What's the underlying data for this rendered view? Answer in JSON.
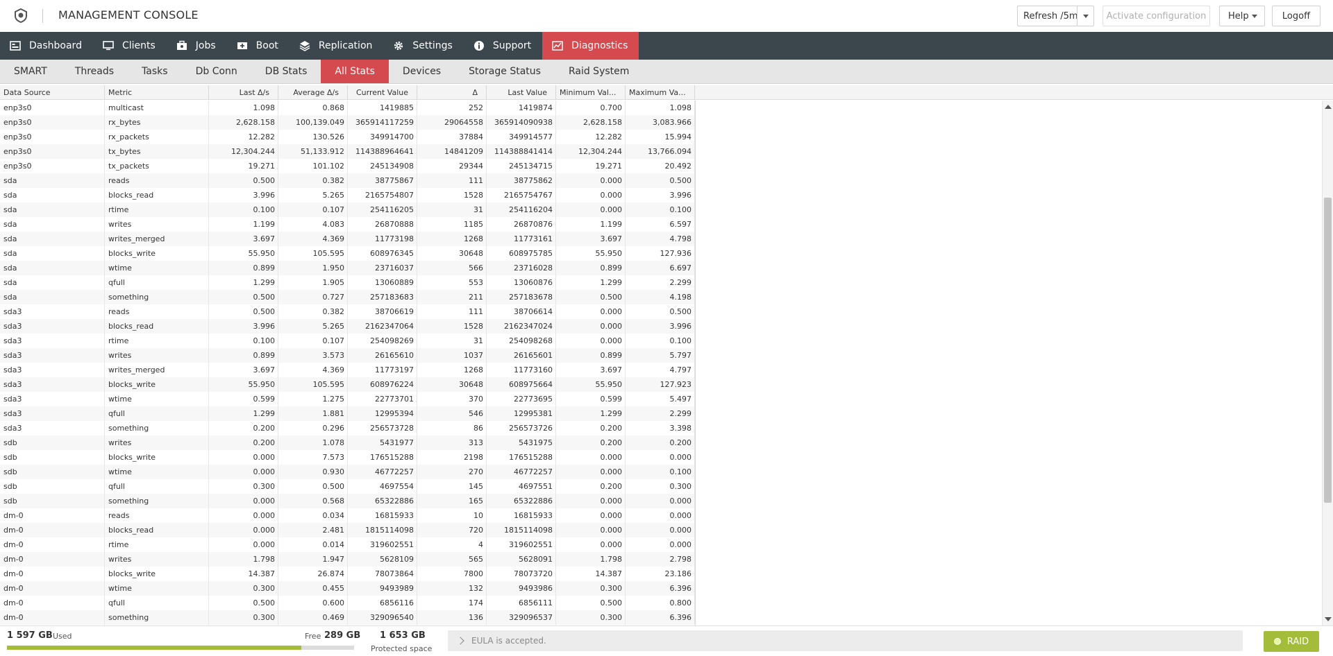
{
  "header": {
    "title": "MANAGEMENT CONSOLE",
    "refresh_label": "Refresh /5m",
    "activate_label": "Activate configuration",
    "help_label": "Help",
    "logoff_label": "Logoff"
  },
  "main_nav": [
    {
      "label": "Dashboard",
      "icon": "dashboard-icon"
    },
    {
      "label": "Clients",
      "icon": "monitor-icon"
    },
    {
      "label": "Jobs",
      "icon": "jobs-icon"
    },
    {
      "label": "Boot",
      "icon": "boot-icon"
    },
    {
      "label": "Replication",
      "icon": "layers-icon"
    },
    {
      "label": "Settings",
      "icon": "gear-icon"
    },
    {
      "label": "Support",
      "icon": "info-icon"
    },
    {
      "label": "Diagnostics",
      "icon": "chart-icon",
      "active": true
    }
  ],
  "sub_nav": [
    {
      "label": "SMART"
    },
    {
      "label": "Threads"
    },
    {
      "label": "Tasks"
    },
    {
      "label": "Db Conn"
    },
    {
      "label": "DB Stats"
    },
    {
      "label": "All Stats",
      "active": true
    },
    {
      "label": "Devices"
    },
    {
      "label": "Storage Status"
    },
    {
      "label": "Raid System"
    }
  ],
  "table": {
    "columns": [
      "Data Source",
      "Metric",
      "Last Δ/s",
      "Average Δ/s",
      "Current Value",
      "Δ",
      "Last Value",
      "Minimum Val...",
      "Maximum Va..."
    ],
    "rows": [
      [
        "enp3s0",
        "multicast",
        "1.098",
        "0.868",
        "1419885",
        "252",
        "1419874",
        "0.700",
        "1.098"
      ],
      [
        "enp3s0",
        "rx_bytes",
        "2,628.158",
        "100,139.049",
        "365914117259",
        "29064558",
        "365914090938",
        "2,628.158",
        "3,083.966"
      ],
      [
        "enp3s0",
        "rx_packets",
        "12.282",
        "130.526",
        "349914700",
        "37884",
        "349914577",
        "12.282",
        "15.994"
      ],
      [
        "enp3s0",
        "tx_bytes",
        "12,304.244",
        "51,133.912",
        "114388964641",
        "14841209",
        "114388841414",
        "12,304.244",
        "13,766.094"
      ],
      [
        "enp3s0",
        "tx_packets",
        "19.271",
        "101.102",
        "245134908",
        "29344",
        "245134715",
        "19.271",
        "20.492"
      ],
      [
        "sda",
        "reads",
        "0.500",
        "0.382",
        "38775867",
        "111",
        "38775862",
        "0.000",
        "0.500"
      ],
      [
        "sda",
        "blocks_read",
        "3.996",
        "5.265",
        "2165754807",
        "1528",
        "2165754767",
        "0.000",
        "3.996"
      ],
      [
        "sda",
        "rtime",
        "0.100",
        "0.107",
        "254116205",
        "31",
        "254116204",
        "0.000",
        "0.100"
      ],
      [
        "sda",
        "writes",
        "1.199",
        "4.083",
        "26870888",
        "1185",
        "26870876",
        "1.199",
        "6.597"
      ],
      [
        "sda",
        "writes_merged",
        "3.697",
        "4.369",
        "11773198",
        "1268",
        "11773161",
        "3.697",
        "4.798"
      ],
      [
        "sda",
        "blocks_write",
        "55.950",
        "105.595",
        "608976345",
        "30648",
        "608975785",
        "55.950",
        "127.936"
      ],
      [
        "sda",
        "wtime",
        "0.899",
        "1.950",
        "23716037",
        "566",
        "23716028",
        "0.899",
        "6.697"
      ],
      [
        "sda",
        "qfull",
        "1.299",
        "1.905",
        "13060889",
        "553",
        "13060876",
        "1.299",
        "2.299"
      ],
      [
        "sda",
        "something",
        "0.500",
        "0.727",
        "257183683",
        "211",
        "257183678",
        "0.500",
        "4.198"
      ],
      [
        "sda3",
        "reads",
        "0.500",
        "0.382",
        "38706619",
        "111",
        "38706614",
        "0.000",
        "0.500"
      ],
      [
        "sda3",
        "blocks_read",
        "3.996",
        "5.265",
        "2162347064",
        "1528",
        "2162347024",
        "0.000",
        "3.996"
      ],
      [
        "sda3",
        "rtime",
        "0.100",
        "0.107",
        "254098269",
        "31",
        "254098268",
        "0.000",
        "0.100"
      ],
      [
        "sda3",
        "writes",
        "0.899",
        "3.573",
        "26165610",
        "1037",
        "26165601",
        "0.899",
        "5.797"
      ],
      [
        "sda3",
        "writes_merged",
        "3.697",
        "4.369",
        "11773197",
        "1268",
        "11773160",
        "3.697",
        "4.797"
      ],
      [
        "sda3",
        "blocks_write",
        "55.950",
        "105.595",
        "608976224",
        "30648",
        "608975664",
        "55.950",
        "127.923"
      ],
      [
        "sda3",
        "wtime",
        "0.599",
        "1.275",
        "22773701",
        "370",
        "22773695",
        "0.599",
        "5.497"
      ],
      [
        "sda3",
        "qfull",
        "1.299",
        "1.881",
        "12995394",
        "546",
        "12995381",
        "1.299",
        "2.299"
      ],
      [
        "sda3",
        "something",
        "0.200",
        "0.296",
        "256573728",
        "86",
        "256573726",
        "0.200",
        "3.398"
      ],
      [
        "sdb",
        "writes",
        "0.200",
        "1.078",
        "5431977",
        "313",
        "5431975",
        "0.200",
        "0.200"
      ],
      [
        "sdb",
        "blocks_write",
        "0.000",
        "7.573",
        "176515288",
        "2198",
        "176515288",
        "0.000",
        "0.000"
      ],
      [
        "sdb",
        "wtime",
        "0.000",
        "0.930",
        "46772257",
        "270",
        "46772257",
        "0.000",
        "0.100"
      ],
      [
        "sdb",
        "qfull",
        "0.300",
        "0.500",
        "4697554",
        "145",
        "4697551",
        "0.200",
        "0.300"
      ],
      [
        "sdb",
        "something",
        "0.000",
        "0.568",
        "65322886",
        "165",
        "65322886",
        "0.000",
        "0.000"
      ],
      [
        "dm-0",
        "reads",
        "0.000",
        "0.034",
        "16815933",
        "10",
        "16815933",
        "0.000",
        "0.000"
      ],
      [
        "dm-0",
        "blocks_read",
        "0.000",
        "2.481",
        "1815114098",
        "720",
        "1815114098",
        "0.000",
        "0.000"
      ],
      [
        "dm-0",
        "rtime",
        "0.000",
        "0.014",
        "319602551",
        "4",
        "319602551",
        "0.000",
        "0.000"
      ],
      [
        "dm-0",
        "writes",
        "1.798",
        "1.947",
        "5628109",
        "565",
        "5628091",
        "1.798",
        "2.798"
      ],
      [
        "dm-0",
        "blocks_write",
        "14.387",
        "26.874",
        "78073864",
        "7800",
        "78073720",
        "14.387",
        "23.186"
      ],
      [
        "dm-0",
        "wtime",
        "0.300",
        "0.455",
        "9493989",
        "132",
        "9493986",
        "0.300",
        "6.396"
      ],
      [
        "dm-0",
        "qfull",
        "0.500",
        "0.600",
        "6856116",
        "174",
        "6856111",
        "0.500",
        "0.800"
      ],
      [
        "dm-0",
        "something",
        "0.300",
        "0.469",
        "329096540",
        "136",
        "329096537",
        "0.300",
        "6.396"
      ]
    ]
  },
  "footer": {
    "used_value": "1 597 GB",
    "used_label": "Used",
    "free_label": "Free",
    "free_value": "289 GB",
    "used_fraction": 0.847,
    "protected_value": "1 653 GB",
    "protected_label": "Protected space",
    "message": "EULA is accepted.",
    "raid_label": "RAID"
  },
  "colors": {
    "nav_bg": "#3c464d",
    "accent_red": "#d44a4f",
    "ok_green": "#a3bd3a"
  }
}
